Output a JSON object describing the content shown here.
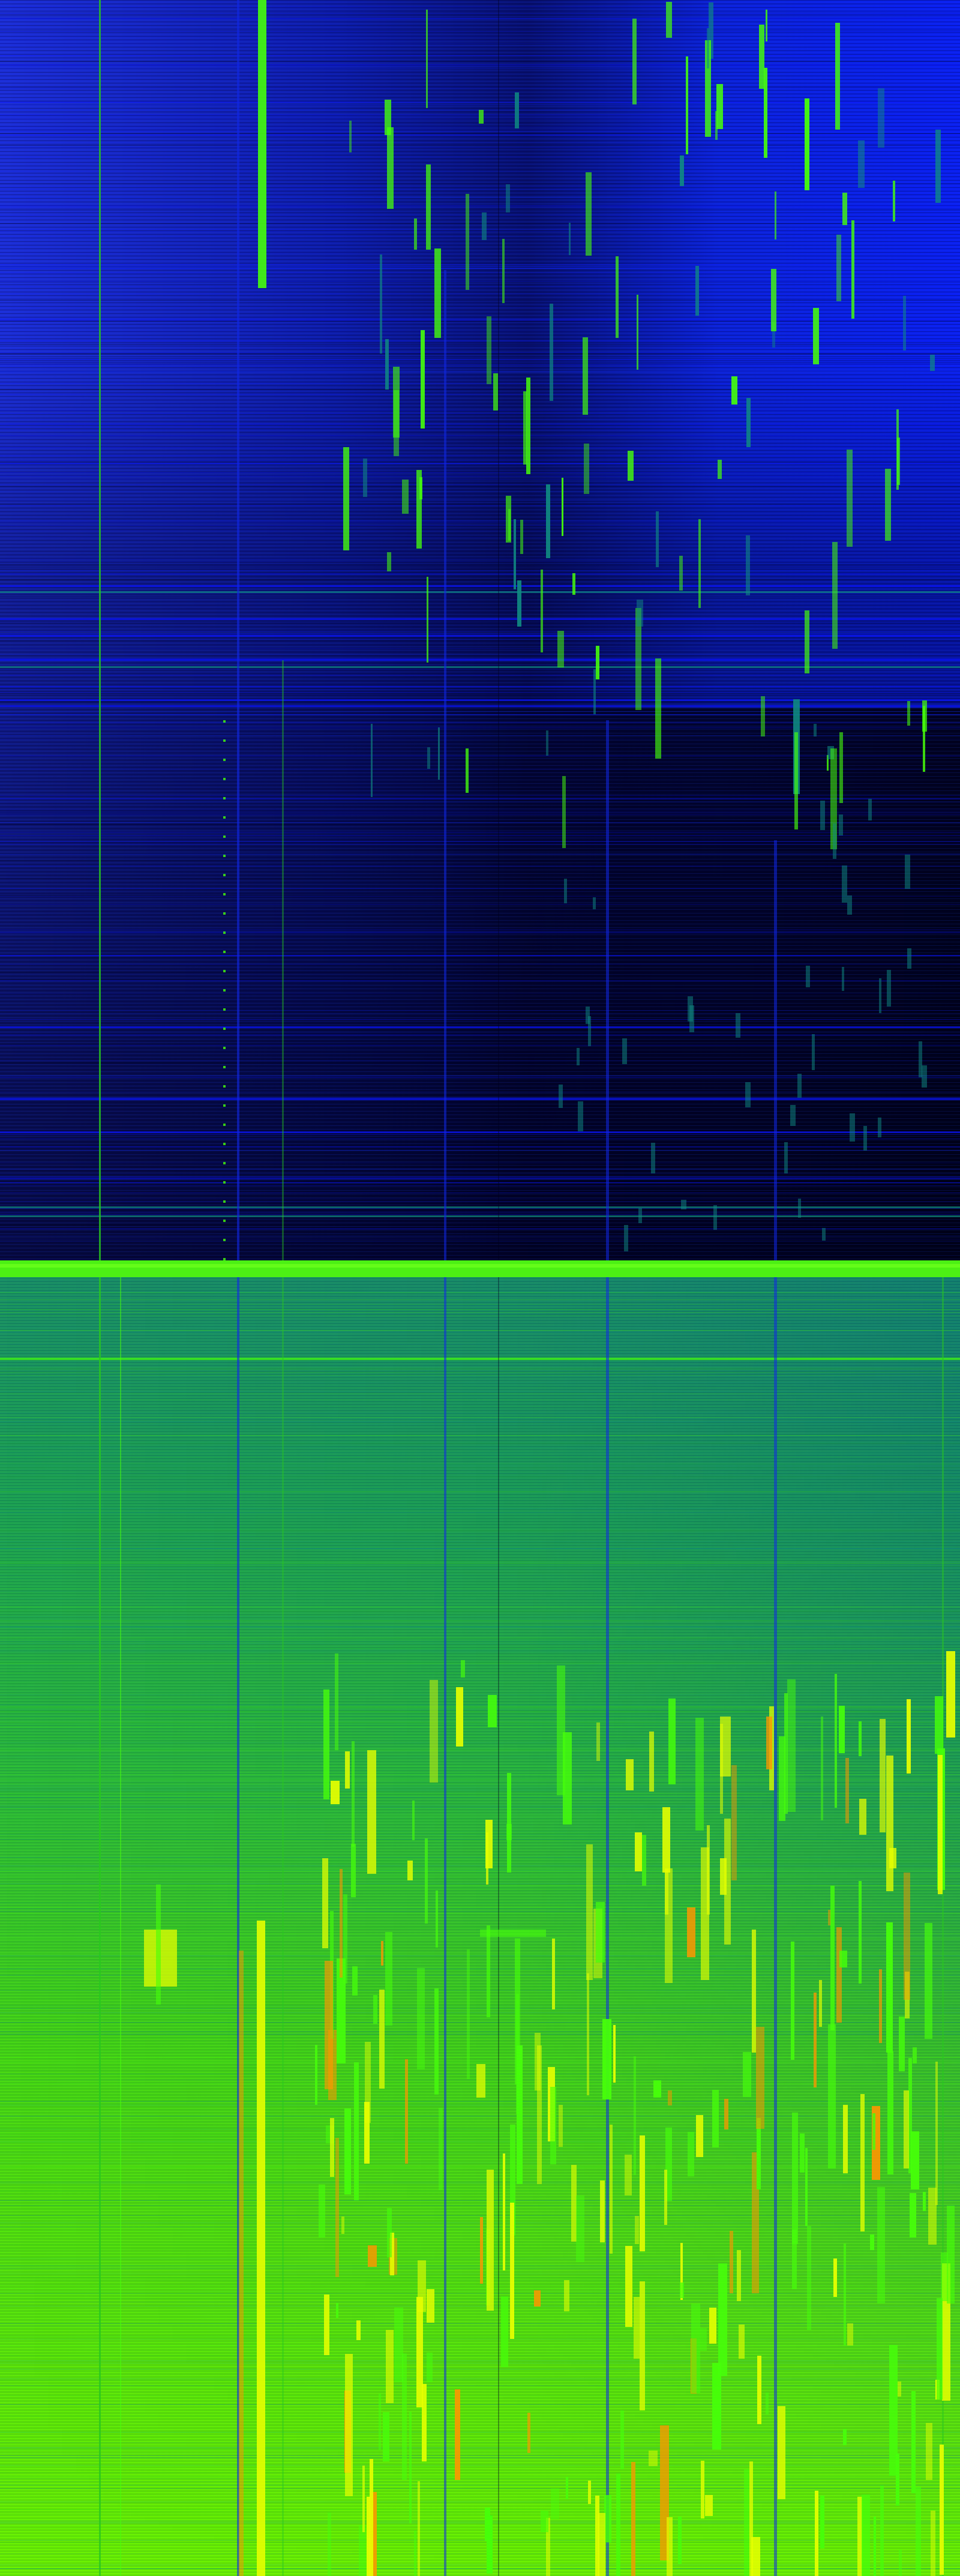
{
  "view": {
    "kind": "spectrogram-waterfall",
    "colormap": [
      "#00001a",
      "#0a0a8c",
      "#1030e0",
      "#0a7a7a",
      "#16b43a",
      "#3cf000",
      "#a6ff00",
      "#fff200",
      "#ff8c00",
      "#e60000"
    ],
    "palette": {
      "deep_background": "#00001e",
      "blue": "#1028e6",
      "bright_blue": "#0a14ff",
      "teal": "#108c82",
      "green": "#28c81e",
      "bright_green": "#46ff0a",
      "yellow": "#e6ff00",
      "orange": "#ff9600",
      "red": "#ff2800"
    },
    "text_elements": []
  }
}
